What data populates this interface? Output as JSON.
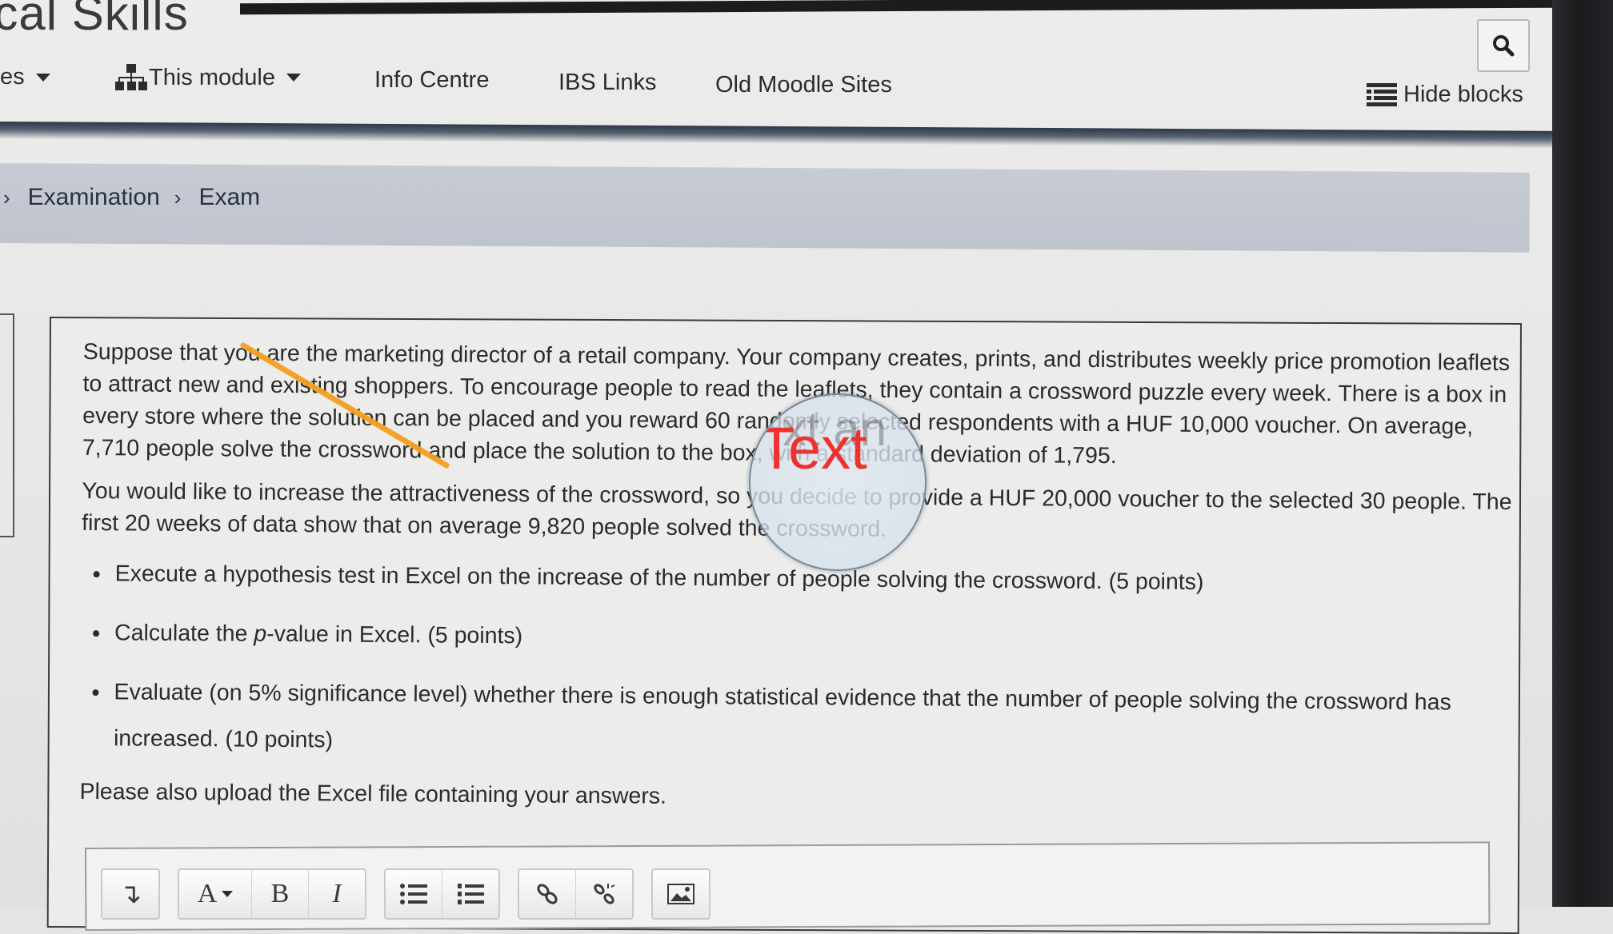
{
  "header": {
    "site_title": "ical Skills",
    "search_icon": "search-icon"
  },
  "nav": {
    "items": [
      {
        "label": "es",
        "dropdown": true
      },
      {
        "label": "This module",
        "dropdown": true,
        "icon": "sitemap-icon"
      },
      {
        "label": "Info Centre"
      },
      {
        "label": "IBS Links"
      },
      {
        "label": "Old Moodle Sites"
      }
    ],
    "hide_blocks": {
      "label": "Hide blocks",
      "icon": "list-icon"
    }
  },
  "breadcrumb": {
    "items": [
      "Examination",
      "Exam"
    ]
  },
  "question": {
    "paragraph_1": "Suppose that you are the marketing director of a retail company. Your company creates, prints, and distributes weekly price promotion leaflets to attract new and existing shoppers. To encourage people to read the leaflets, they contain a crossword puzzle every week. There is a box in every store where the solution can be placed and you reward 60 randomly selected respondents with a HUF 10,000 voucher. On average, 7,710 people solve the crossword and place the solution to the box, with a standard deviation of 1,795.",
    "paragraph_2": "You would like to increase the attractiveness of the crossword, so you decide to provide a HUF 20,000 voucher to the selected 30 people. The first 20 weeks of data show that on average 9,820 people solved the crossword.",
    "bullets": [
      {
        "text": "Execute a hypothesis test in Excel on the increase of the number of people solving the crossword. (5 points)"
      },
      {
        "before": "Calculate the ",
        "italic": "p",
        "after": "-value in Excel. (5 points)"
      },
      {
        "text": "Evaluate (on 5% significance level) whether there is enough statistical evidence that the number of people solving the crossword has increased. (10 points)"
      }
    ],
    "upload_note": "Please also upload the Excel file containing your answers."
  },
  "editor": {
    "toolbar": [
      {
        "group": "format",
        "buttons": [
          {
            "name": "collapse-icon",
            "label": "↴"
          }
        ]
      },
      {
        "group": "style",
        "buttons": [
          {
            "name": "font-style-icon",
            "label": "A"
          },
          {
            "name": "bold-icon",
            "label": "B"
          },
          {
            "name": "italic-icon",
            "label": "I"
          }
        ]
      },
      {
        "group": "lists",
        "buttons": [
          {
            "name": "bullet-list-icon",
            "label": ""
          },
          {
            "name": "numbered-list-icon",
            "label": ""
          }
        ]
      },
      {
        "group": "links",
        "buttons": [
          {
            "name": "link-icon",
            "label": ""
          },
          {
            "name": "unlink-icon",
            "label": ""
          }
        ]
      },
      {
        "group": "media",
        "buttons": [
          {
            "name": "image-icon",
            "label": ""
          }
        ]
      }
    ]
  },
  "overlay": {
    "lens_text": "Text",
    "lens_text_back": "xt an",
    "annotation_color": "#f5a623",
    "lens_text_color": "#ee3030"
  }
}
